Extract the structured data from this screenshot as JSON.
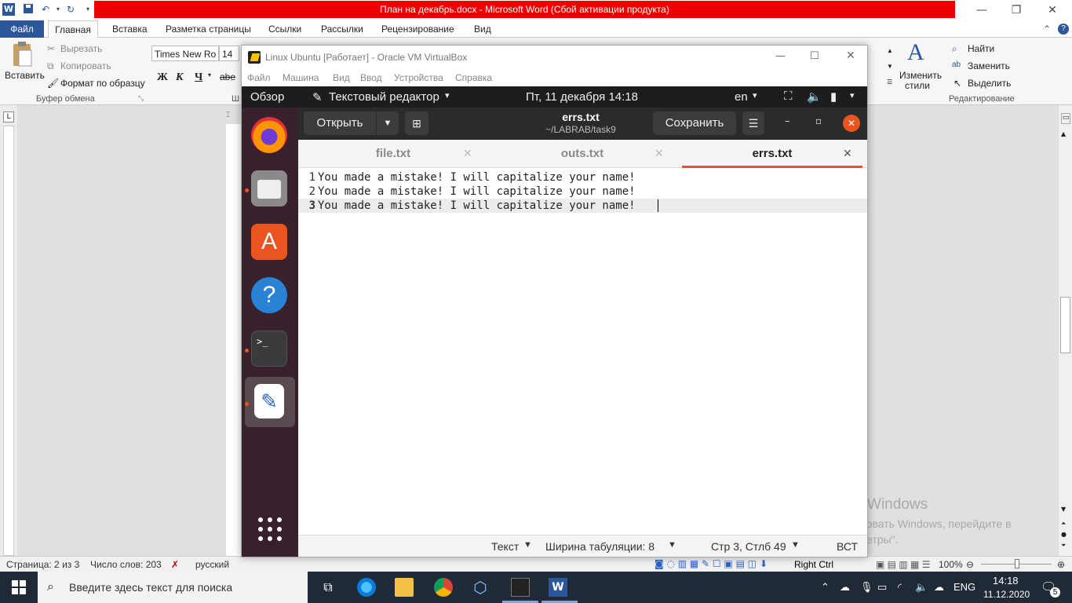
{
  "word": {
    "title": "План на декабрь.docx  -  Microsoft Word (Сбой активации продукта)",
    "tabs": [
      "Файл",
      "Главная",
      "Вставка",
      "Разметка страницы",
      "Ссылки",
      "Рассылки",
      "Рецензирование",
      "Вид"
    ],
    "clipboard": {
      "paste": "Вставить",
      "cut": "Вырезать",
      "copy": "Копировать",
      "format_painter": "Формат по образцу",
      "group": "Буфер обмена"
    },
    "font": {
      "name": "Times New Ro",
      "size": "14",
      "bold": "Ж",
      "italic": "К",
      "underline": "Ч",
      "strike": "abe"
    },
    "styles": {
      "change": "Изменить",
      "change2": "стили"
    },
    "editing": {
      "find": "Найти",
      "replace": "Заменить",
      "select": "Выделить",
      "group": "Редактирование"
    },
    "group_partial": "Ш",
    "status": {
      "page": "Страница: 2 из 3",
      "words": "Число слов: 203",
      "lang": "русский",
      "zoom": "100%"
    },
    "watermark": {
      "title": "Активация Windows",
      "text": "Чтобы активировать Windows, перейдите в раздел \"Параметры\"."
    },
    "colors": {
      "accent": "#2b579a",
      "title_error": "#ee0000"
    }
  },
  "virtualbox": {
    "title": "Linux Ubuntu [Работает] - Oracle VM VirtualBox",
    "menu": [
      "Файл",
      "Машина",
      "Вид",
      "Ввод",
      "Устройства",
      "Справка"
    ],
    "host_key": "Right Ctrl"
  },
  "ubuntu": {
    "topbar": {
      "activities": "Обзор",
      "app": "Текстовый редактор",
      "clock": "Пт, 11 декабря  14:18",
      "lang": "en"
    },
    "dock": [
      "firefox-icon",
      "files-icon",
      "software-icon",
      "help-icon",
      "terminal-icon",
      "text-editor-icon",
      "apps-grid-icon"
    ],
    "editor": {
      "open": "Открыть",
      "save": "Сохранить",
      "filename": "errs.txt",
      "path": "~/LABRAB/task9",
      "tabs": [
        {
          "label": "file.txt",
          "active": false
        },
        {
          "label": "outs.txt",
          "active": false
        },
        {
          "label": "errs.txt",
          "active": true
        }
      ],
      "lines": [
        {
          "n": "1",
          "text": "You made a mistake! I will capitalize your name!"
        },
        {
          "n": "2",
          "text": "You made a mistake! I will capitalize your name!"
        },
        {
          "n": "3",
          "text": "You made a mistake! I will capitalize your name!"
        }
      ],
      "status": {
        "syntax": "Текст",
        "tab_width": "Ширина табуляции: 8",
        "position": "Стр 3, Стлб 49",
        "mode": "ВСТ"
      }
    },
    "colors": {
      "accent": "#e95420",
      "dock": "#38202c"
    }
  },
  "taskbar": {
    "search_placeholder": "Введите здесь текст для поиска",
    "lang": "ENG",
    "time": "14:18",
    "date": "11.12.2020",
    "notifications": "5"
  }
}
